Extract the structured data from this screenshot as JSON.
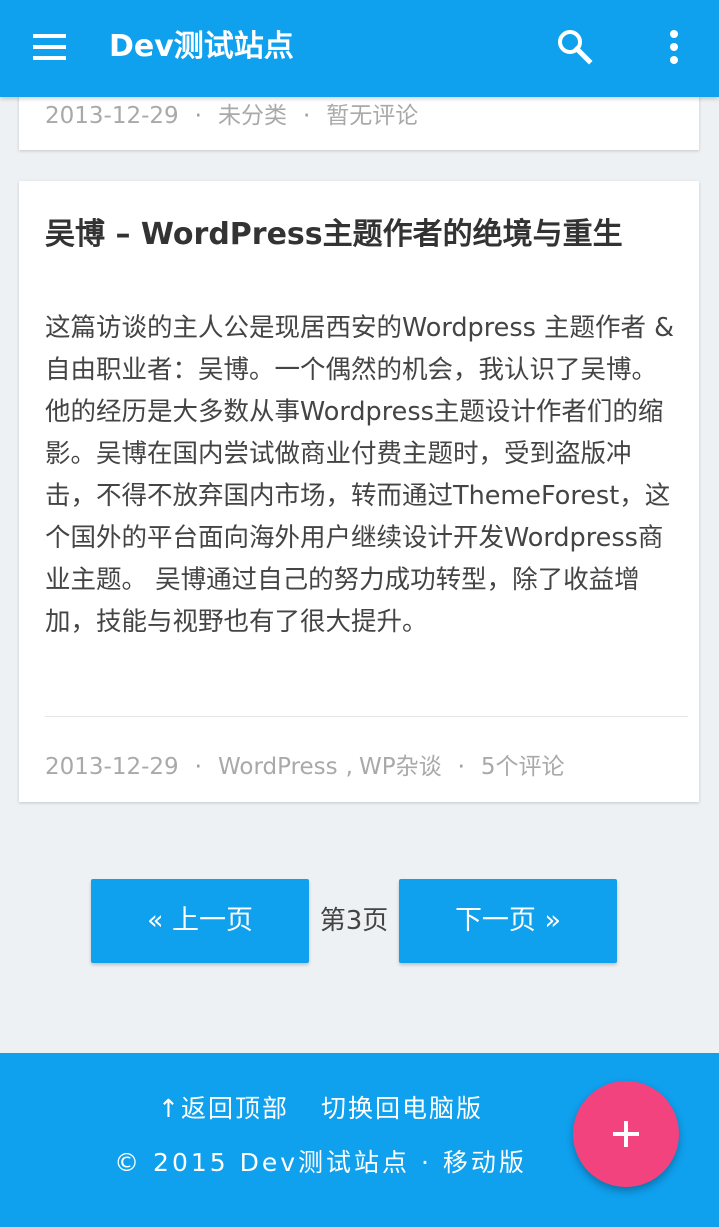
{
  "appbar": {
    "title": "Dev测试站点",
    "menu_icon": "menu-icon",
    "search_icon": "search-icon",
    "more_icon": "more-vert-icon",
    "color": "#0fa0ee"
  },
  "previous_post": {
    "date": "2013-12-29",
    "category": "未分类",
    "comments": "暂无评论"
  },
  "post": {
    "title": "吴博 – WordPress主题作者的绝境与重生",
    "excerpt": "这篇访谈的主人公是现居西安的Wordpress 主题作者 & 自由职业者：吴博。一个偶然的机会，我认识了吴博。他的经历是大多数从事Wordpress主题设计作者们的缩影。吴博在国内尝试做商业付费主题时，受到盗版冲击，不得不放弃国内市场，转而通过ThemeForest，这个国外的平台面向海外用户继续设计开发Wordpress商业主题。 吴博通过自己的努力成功转型，除了收益增加，技能与视野也有了很大提升。",
    "date": "2013-12-29",
    "categories": [
      "WordPress",
      "WP杂谈"
    ],
    "category_separator": ",",
    "comments": "5个评论"
  },
  "meta_separator": "·",
  "pagination": {
    "prev_label": "« 上一页",
    "current": "第3页",
    "next_label": "下一页 »"
  },
  "footer": {
    "back_to_top": "↑返回顶部",
    "desktop_version": "切换回电脑版",
    "copyright": "© 2015 Dev测试站点 · 移动版"
  },
  "fab": {
    "icon": "plus-icon",
    "color": "#f2437f"
  }
}
